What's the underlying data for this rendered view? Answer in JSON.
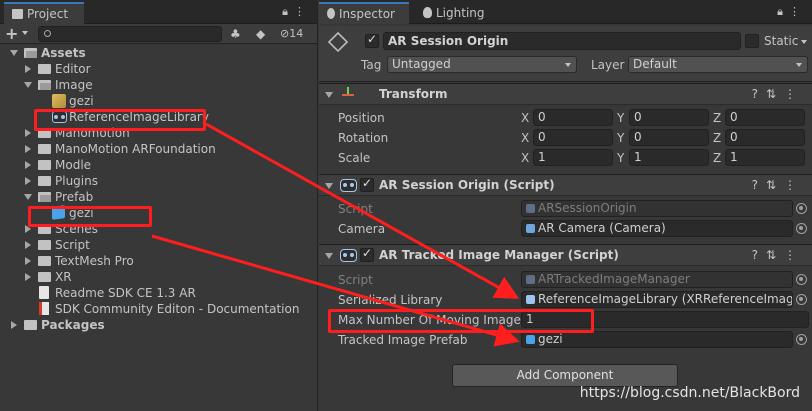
{
  "project": {
    "tab": "Project",
    "search_placeholder": "",
    "hidden_count": "14",
    "tree": [
      {
        "label": "Assets",
        "kind": "root-open"
      },
      {
        "label": "Editor",
        "kind": "folder"
      },
      {
        "label": "Image",
        "kind": "folder-open"
      },
      {
        "label": "gezi",
        "kind": "image"
      },
      {
        "label": "ReferenceImageLibrary",
        "kind": "library"
      },
      {
        "label": "Manomotion",
        "kind": "folder"
      },
      {
        "label": "ManoMotion ARFoundation",
        "kind": "folder"
      },
      {
        "label": "Modle",
        "kind": "folder"
      },
      {
        "label": "Plugins",
        "kind": "folder"
      },
      {
        "label": "Prefab",
        "kind": "folder-open"
      },
      {
        "label": "gezi",
        "kind": "prefab"
      },
      {
        "label": "Scenes",
        "kind": "folder"
      },
      {
        "label": "Script",
        "kind": "folder"
      },
      {
        "label": "TextMesh Pro",
        "kind": "folder"
      },
      {
        "label": "XR",
        "kind": "folder"
      },
      {
        "label": "Readme SDK CE 1.3 AR",
        "kind": "doc"
      },
      {
        "label": "SDK Community Editon - Documentation",
        "kind": "pdf"
      },
      {
        "label": "Packages",
        "kind": "root-closed"
      }
    ]
  },
  "inspector": {
    "tab_inspector": "Inspector",
    "tab_lighting": "Lighting",
    "object_name": "AR Session Origin",
    "static_label": "Static",
    "tag_label": "Tag",
    "tag_value": "Untagged",
    "layer_label": "Layer",
    "layer_value": "Default",
    "transform": {
      "title": "Transform",
      "position_label": "Position",
      "rotation_label": "Rotation",
      "scale_label": "Scale",
      "axes": [
        "X",
        "Y",
        "Z"
      ],
      "position": [
        "0",
        "0",
        "0"
      ],
      "rotation": [
        "0",
        "0",
        "0"
      ],
      "scale": [
        "1",
        "1",
        "1"
      ]
    },
    "session_origin": {
      "title": "AR Session Origin (Script)",
      "script_label": "Script",
      "script_value": "ARSessionOrigin",
      "camera_label": "Camera",
      "camera_value": "AR Camera (Camera)"
    },
    "tracked_image": {
      "title": "AR Tracked Image Manager (Script)",
      "script_label": "Script",
      "script_value": "ARTrackedImageManager",
      "library_label": "Serialized Library",
      "library_value": "ReferenceImageLibrary (XRReferenceImageL",
      "max_label": "Max Number Of Moving Images",
      "max_value": "1",
      "prefab_label": "Tracked Image Prefab",
      "prefab_value": "gezi"
    },
    "add_component": "Add Component"
  },
  "watermark": "https://blog.csdn.net/BlackBord",
  "colors": {
    "annotation_red": "#ff1e1e",
    "tab_accent": "#3a79bb"
  }
}
